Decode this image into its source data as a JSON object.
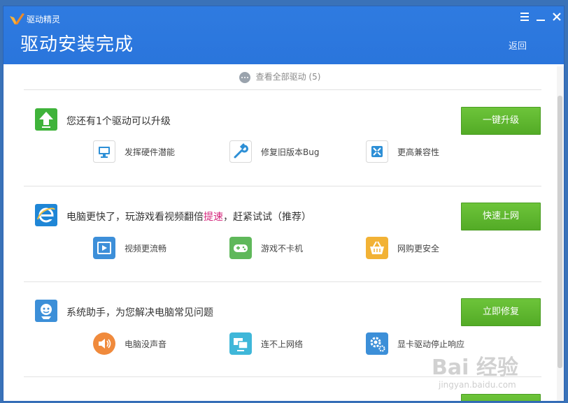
{
  "header": {
    "app_name": "驱动精灵",
    "title": "驱动安装完成",
    "back_label": "返回"
  },
  "view_all": {
    "label": "查看全部驱动 (5)"
  },
  "sections": [
    {
      "title_parts": [
        "您还有1个驱动可以升级",
        "",
        ""
      ],
      "button": "一键升级",
      "features": [
        "发挥硬件潜能",
        "修复旧版本Bug",
        "更高兼容性"
      ]
    },
    {
      "title_parts": [
        "电脑更快了，玩游戏看视频翻倍",
        "提速",
        "，赶紧试试（推荐）"
      ],
      "button": "快速上网",
      "features": [
        "视频更流畅",
        "游戏不卡机",
        "网购更安全"
      ]
    },
    {
      "title_parts": [
        "系统助手，为您解决电脑常见问题",
        "",
        ""
      ],
      "button": "立即修复",
      "features": [
        "电脑没声音",
        "连不上网络",
        "显卡驱动停止响应"
      ]
    }
  ],
  "watermark": {
    "text": "Bai 经验",
    "sub": "jingyan.baidu.com"
  },
  "colors": {
    "header": "#2a75dc",
    "button": "#5cb82e",
    "highlight": "#d4237a"
  }
}
